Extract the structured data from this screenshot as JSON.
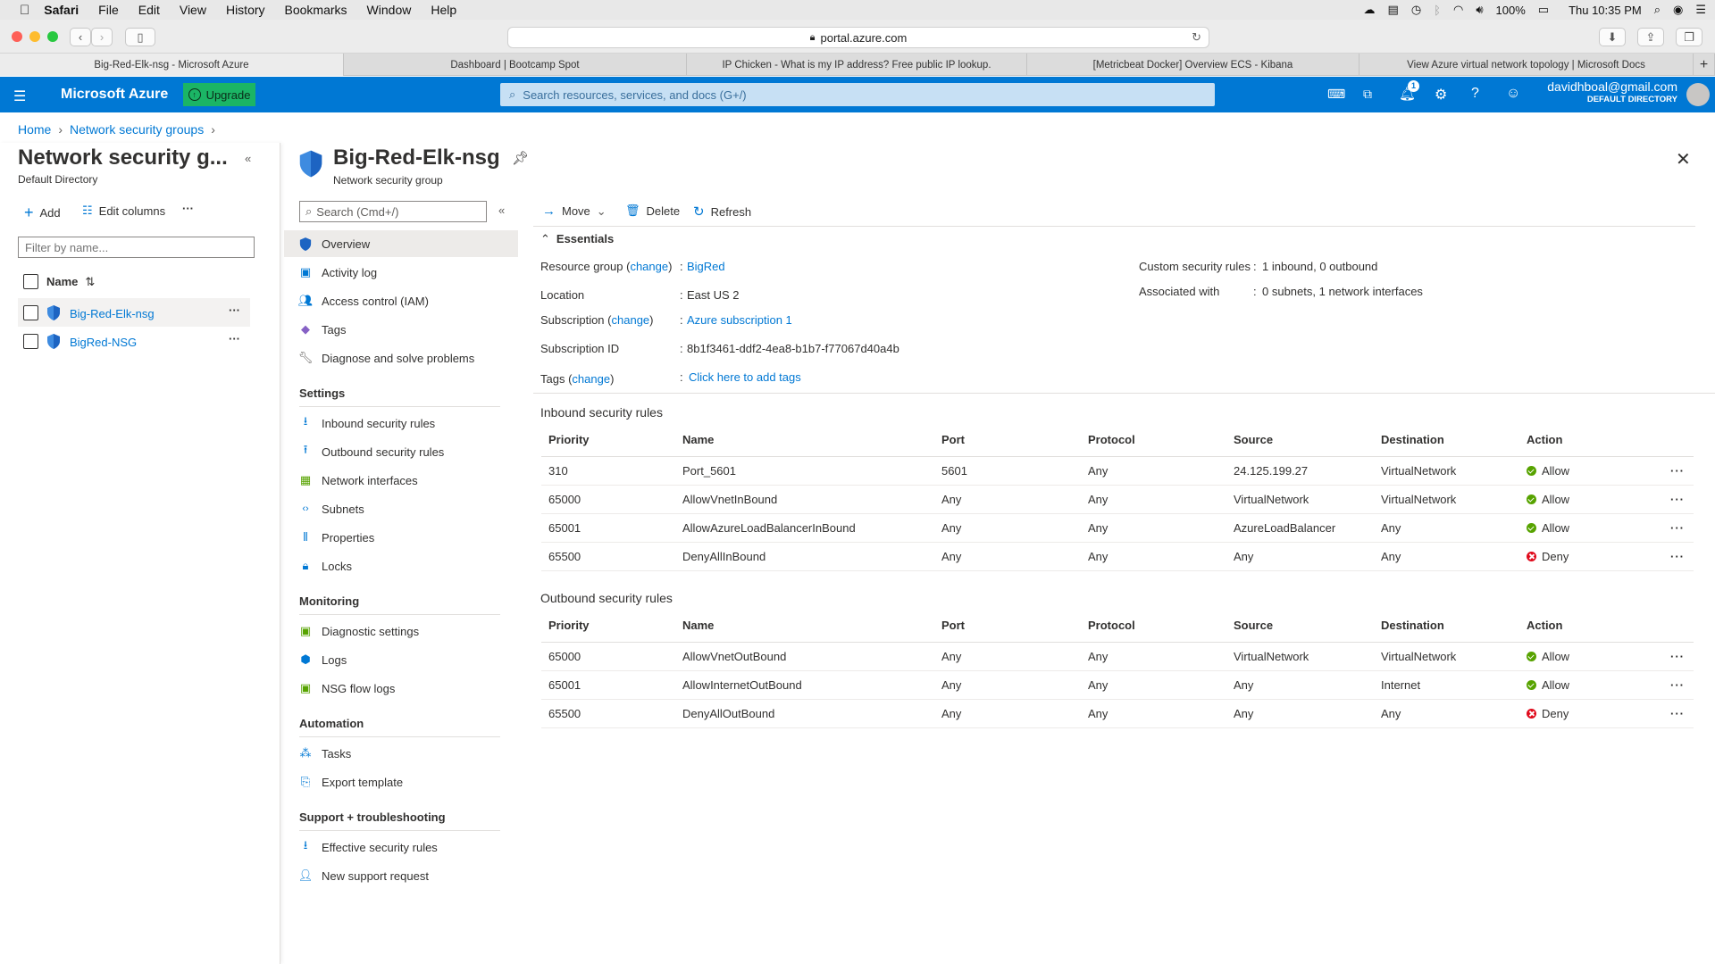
{
  "menubar": {
    "app": "Safari",
    "items": [
      "File",
      "Edit",
      "View",
      "History",
      "Bookmarks",
      "Window",
      "Help"
    ],
    "battery": "100%",
    "clock": "Thu 10:35 PM"
  },
  "browser": {
    "url": "portal.azure.com",
    "tabs": [
      "Big-Red-Elk-nsg - Microsoft Azure",
      "Dashboard | Bootcamp Spot",
      "IP Chicken - What is my IP address? Free public IP lookup.",
      "[Metricbeat Docker] Overview ECS - Kibana",
      "View Azure virtual network topology | Microsoft Docs"
    ]
  },
  "azure": {
    "brand": "Microsoft Azure",
    "upgrade": "Upgrade",
    "search_placeholder": "Search resources, services, and docs (G+/)",
    "notif_count": "1",
    "user_email": "davidhboal@gmail.com",
    "user_directory": "DEFAULT DIRECTORY"
  },
  "breadcrumb": [
    "Home",
    "Network security groups"
  ],
  "list_panel": {
    "title": "Network security g...",
    "subtitle": "Default Directory",
    "add": "Add",
    "edit_columns": "Edit columns",
    "filter_placeholder": "Filter by name...",
    "col_name": "Name",
    "items": [
      "Big-Red-Elk-nsg",
      "BigRed-NSG"
    ]
  },
  "resource": {
    "title": "Big-Red-Elk-nsg",
    "subtitle": "Network security group"
  },
  "menu": {
    "search_placeholder": "Search (Cmd+/)",
    "top": [
      "Overview",
      "Activity log",
      "Access control (IAM)",
      "Tags",
      "Diagnose and solve problems"
    ],
    "settings_header": "Settings",
    "settings": [
      "Inbound security rules",
      "Outbound security rules",
      "Network interfaces",
      "Subnets",
      "Properties",
      "Locks"
    ],
    "monitoring_header": "Monitoring",
    "monitoring": [
      "Diagnostic settings",
      "Logs",
      "NSG flow logs"
    ],
    "automation_header": "Automation",
    "automation": [
      "Tasks",
      "Export template"
    ],
    "support_header": "Support + troubleshooting",
    "support": [
      "Effective security rules",
      "New support request"
    ]
  },
  "commands": {
    "move": "Move",
    "delete": "Delete",
    "refresh": "Refresh"
  },
  "essentials": {
    "header": "Essentials",
    "rg_label": "Resource group",
    "change": "change",
    "rg_value": "BigRed",
    "loc_label": "Location",
    "loc_value": "East US 2",
    "sub_label": "Subscription",
    "sub_value": "Azure subscription 1",
    "subid_label": "Subscription ID",
    "subid_value": "8b1f3461-ddf2-4ea8-b1b7-f77067d40a4b",
    "tags_label": "Tags",
    "tags_value": "Click here to add tags",
    "csr_label": "Custom security rules",
    "csr_value": "1 inbound, 0 outbound",
    "assoc_label": "Associated with",
    "assoc_value": "0 subnets, 1 network interfaces"
  },
  "columns": [
    "Priority",
    "Name",
    "Port",
    "Protocol",
    "Source",
    "Destination",
    "Action"
  ],
  "inbound": {
    "title": "Inbound security rules",
    "rows": [
      {
        "priority": "310",
        "name": "Port_5601",
        "port": "5601",
        "protocol": "Any",
        "source": "24.125.199.27",
        "destination": "VirtualNetwork",
        "action": "Allow"
      },
      {
        "priority": "65000",
        "name": "AllowVnetInBound",
        "port": "Any",
        "protocol": "Any",
        "source": "VirtualNetwork",
        "destination": "VirtualNetwork",
        "action": "Allow"
      },
      {
        "priority": "65001",
        "name": "AllowAzureLoadBalancerInBound",
        "port": "Any",
        "protocol": "Any",
        "source": "AzureLoadBalancer",
        "destination": "Any",
        "action": "Allow"
      },
      {
        "priority": "65500",
        "name": "DenyAllInBound",
        "port": "Any",
        "protocol": "Any",
        "source": "Any",
        "destination": "Any",
        "action": "Deny"
      }
    ]
  },
  "outbound": {
    "title": "Outbound security rules",
    "rows": [
      {
        "priority": "65000",
        "name": "AllowVnetOutBound",
        "port": "Any",
        "protocol": "Any",
        "source": "VirtualNetwork",
        "destination": "VirtualNetwork",
        "action": "Allow"
      },
      {
        "priority": "65001",
        "name": "AllowInternetOutBound",
        "port": "Any",
        "protocol": "Any",
        "source": "Any",
        "destination": "Internet",
        "action": "Allow"
      },
      {
        "priority": "65500",
        "name": "DenyAllOutBound",
        "port": "Any",
        "protocol": "Any",
        "source": "Any",
        "destination": "Any",
        "action": "Deny"
      }
    ]
  },
  "colors": {
    "azure_blue": "#0078d4",
    "upgrade_green": "#1bb565",
    "allow": "#57a300",
    "deny": "#e00b1c"
  }
}
